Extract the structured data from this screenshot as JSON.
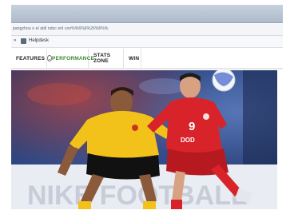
{
  "browser": {
    "url": "pangzhou o el abll ndsc eril con%%6%6%26%6%%"
  },
  "bookmarks": {
    "items": [
      {
        "label": "Helpdesk",
        "icon": "bookmark-folder-icon"
      }
    ]
  },
  "nav": {
    "items": [
      {
        "label": "FEATURES",
        "active": false,
        "icon": "chevron-down-icon"
      },
      {
        "label": "PERFORMANCE",
        "active": true
      },
      {
        "label": "STATS ZONE",
        "active": false
      },
      {
        "label": "WIN",
        "active": false
      }
    ]
  },
  "hero": {
    "player_number": "9",
    "jersey_text": "DOD",
    "banner_text": "NIKE FOOTBALL",
    "colors": {
      "yellow_kit": "#f2c21b",
      "red_kit": "#d8232a",
      "backdrop": "#2a3f74",
      "accent_green": "#3a8a2e"
    }
  }
}
